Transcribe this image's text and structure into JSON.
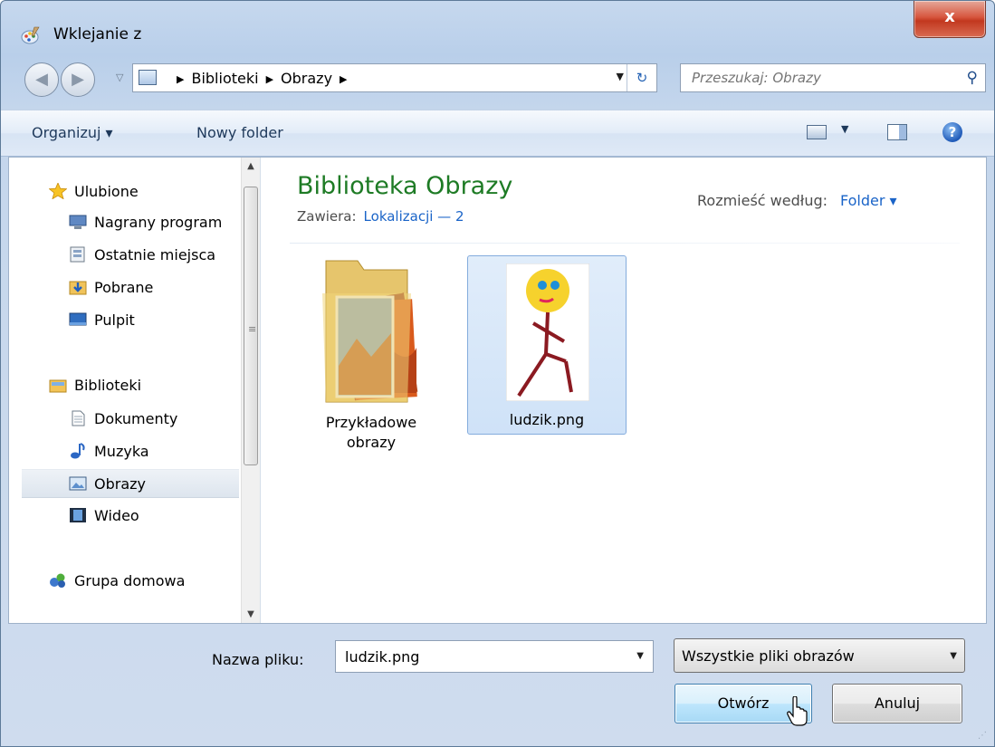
{
  "window": {
    "title": "Wklejanie z",
    "close_label": "x",
    "app_icon": "paint-icon"
  },
  "navbar": {
    "back_icon": "back-arrow-icon",
    "forward_icon": "forward-arrow-icon",
    "breadcrumbs": [
      "Biblioteki",
      "Obrazy"
    ],
    "search_placeholder": "Przeszukaj: Obrazy"
  },
  "toolbar": {
    "organize_label": "Organizuj ▾",
    "new_folder_label": "Nowy folder",
    "help_label": "?"
  },
  "sidebar": {
    "favorites_label": "Ulubione",
    "favorites_items": [
      "Nagrany program",
      "Ostatnie miejsca",
      "Pobrane",
      "Pulpit"
    ],
    "libraries_label": "Biblioteki",
    "libraries_items": [
      "Dokumenty",
      "Muzyka",
      "Obrazy",
      "Wideo"
    ],
    "selected_item": "Obrazy",
    "homegroup_label": "Grupa domowa"
  },
  "main": {
    "library_title": "Biblioteka Obrazy",
    "includes_label": "Zawiera:",
    "includes_link": "Lokalizacji — 2",
    "arrange_label": "Rozmieść według:",
    "arrange_value": "Folder ▾",
    "items": [
      {
        "label_line1": "Przykładowe",
        "label_line2": "obrazy",
        "type": "folder"
      },
      {
        "label_line1": "ludzik.png",
        "label_line2": "",
        "type": "image",
        "selected": true
      }
    ]
  },
  "bottom": {
    "filename_label": "Nazwa pliku:",
    "filename_value": "ludzik.png",
    "filetype_value": "Wszystkie pliki obrazów",
    "open_label": "Otwórz",
    "cancel_label": "Anuluj"
  },
  "colors": {
    "library_title": "#1e7b25",
    "link": "#1a64c8",
    "close_button": "#c8432a",
    "selection": "#cfe2f8"
  }
}
